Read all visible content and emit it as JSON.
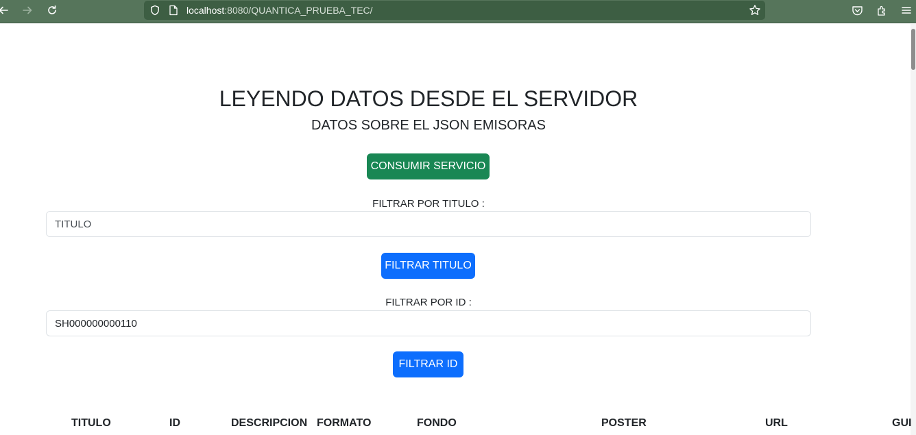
{
  "browser": {
    "url_host": "localhost",
    "url_rest": ":8080/QUANTICA_PRUEBA_TEC/",
    "icons": [
      "back-icon",
      "forward-icon",
      "reload-icon",
      "shield-icon",
      "page-icon",
      "star-icon",
      "pocket-icon",
      "extensions-icon",
      "menu-icon"
    ]
  },
  "page": {
    "title": "LEYENDO DATOS DESDE EL SERVIDOR",
    "subtitle": "DATOS SOBRE EL JSON EMISORAS",
    "consume_button": "CONSUMIR SERVICIO",
    "filter_title_label": "FILTRAR POR TITULO :",
    "title_input_placeholder": "TITULO",
    "title_input_value": "",
    "filter_title_button": "FILTRAR TITULO",
    "filter_id_label": "FILTRAR POR ID :",
    "id_input_value": "SH000000000110",
    "filter_id_button": "FILTRAR ID"
  },
  "table": {
    "headers": [
      "TITULO",
      "ID",
      "DESCRIPCION",
      "FORMATO",
      "FONDO",
      "POSTER",
      "URL",
      "GUI"
    ]
  },
  "colors": {
    "toolbar": "#56755b",
    "green_button": "#198754",
    "blue_button": "#0d6efd"
  }
}
